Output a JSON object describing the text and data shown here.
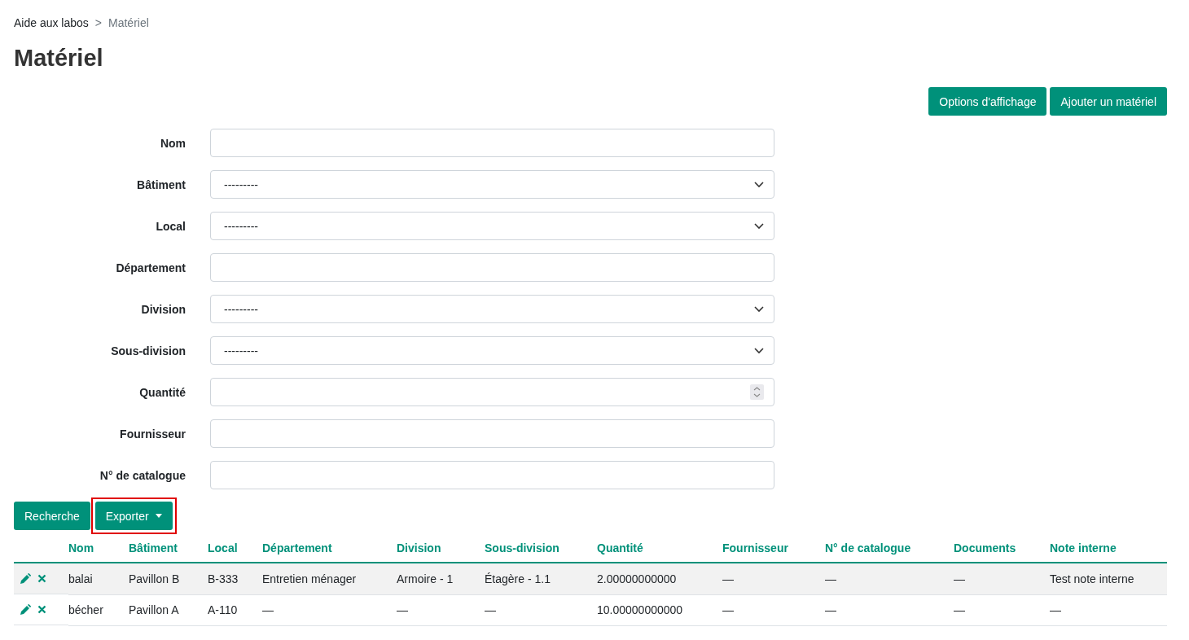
{
  "breadcrumb": {
    "items": [
      "Aide aux labos"
    ],
    "separator": ">",
    "current": "Matériel"
  },
  "title": "Matériel",
  "top_buttons": [
    "Options d'affichage",
    "Ajouter un matériel"
  ],
  "filters": [
    {
      "label": "Nom",
      "kind": "text"
    },
    {
      "label": "Bâtiment",
      "kind": "select",
      "value": "---------"
    },
    {
      "label": "Local",
      "kind": "select",
      "value": "---------"
    },
    {
      "label": "Département",
      "kind": "text"
    },
    {
      "label": "Division",
      "kind": "select",
      "value": "---------"
    },
    {
      "label": "Sous-division",
      "kind": "select",
      "value": "---------"
    },
    {
      "label": "Quantité",
      "kind": "number"
    },
    {
      "label": "Fournisseur",
      "kind": "text"
    },
    {
      "label": "N° de catalogue",
      "kind": "text"
    }
  ],
  "search_button": "Recherche",
  "export_button": {
    "label": "Exporter",
    "highlighted": true
  },
  "table": {
    "columns": [
      "Nom",
      "Bâtiment",
      "Local",
      "Département",
      "Division",
      "Sous-division",
      "Quantité",
      "Fournisseur",
      "N° de catalogue",
      "Documents",
      "Note interne"
    ],
    "rows": [
      {
        "shaded": true,
        "cells": [
          "balai",
          "Pavillon B",
          "B-333",
          "Entretien ménager",
          "Armoire - 1",
          "Étagère - 1.1",
          "2.00000000000",
          "—",
          "—",
          "—",
          "Test note interne"
        ]
      },
      {
        "shaded": false,
        "cells": [
          "bécher",
          "Pavillon A",
          "A-110",
          "—",
          "—",
          "—",
          "10.00000000000",
          "—",
          "—",
          "—",
          "—"
        ]
      }
    ]
  }
}
